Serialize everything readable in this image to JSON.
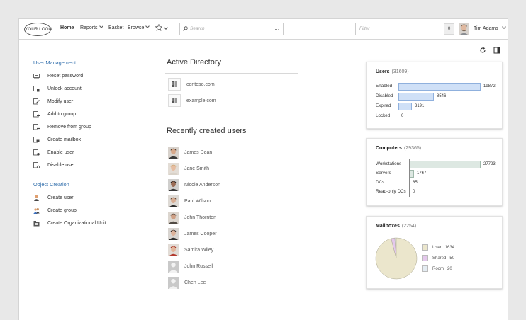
{
  "header": {
    "logo": "YOUR LOGO",
    "nav": {
      "home": "Home",
      "reports": "Reports",
      "basket": "Basket",
      "browse": "Browse"
    },
    "search_placeholder": "Search",
    "search_more": "...",
    "filter_placeholder": "Filter",
    "basket_count": "0",
    "user_name": "Tim Adams"
  },
  "sidebar": {
    "user_management": {
      "heading": "User Management",
      "items": [
        "Reset password",
        "Unlock account",
        "Modify user",
        "Add to group",
        "Remove from group",
        "Create mailbox",
        "Enable user",
        "Disable user"
      ]
    },
    "object_creation": {
      "heading": "Object Creation",
      "items": [
        "Create user",
        "Create group",
        "Create Organizational Unit"
      ]
    }
  },
  "active_directory": {
    "title": "Active Directory",
    "domains": [
      "contoso.com",
      "example.com"
    ]
  },
  "recent_users": {
    "title": "Recently created users",
    "users": [
      "James Dean",
      "Jane Smith",
      "Nicole Anderson",
      "Paul Wilson",
      "John Thornton",
      "James Cooper",
      "Samira Wiley",
      "John Russell",
      "Chen Lee"
    ]
  },
  "widgets": {
    "users": {
      "title": "Users",
      "count": "(31609)",
      "chart_data": {
        "type": "bar",
        "categories": [
          "Enabled",
          "Disabled",
          "Expired",
          "Locked"
        ],
        "values": [
          19872,
          8546,
          3191,
          0
        ],
        "value_labels": [
          "19872",
          "8546",
          "3191",
          "0"
        ],
        "color": "#cfe0f7",
        "border": "#8fb0dd"
      }
    },
    "computers": {
      "title": "Computers",
      "count": "(29365)",
      "chart_data": {
        "type": "bar",
        "categories": [
          "Workstations",
          "Servers",
          "DCs",
          "Read-only DCs"
        ],
        "values": [
          27723,
          1767,
          85,
          0
        ],
        "value_labels": [
          "27723",
          "1767",
          "85",
          "0"
        ],
        "color": "#dde8e2",
        "border": "#9fb8aa"
      }
    },
    "mailboxes": {
      "title": "Mailboxes",
      "count": "(2254)",
      "chart_data": {
        "type": "pie",
        "categories": [
          "User",
          "Shared",
          "Room"
        ],
        "values": [
          1634,
          50,
          20
        ],
        "value_labels": [
          "1634",
          "50",
          "20"
        ],
        "colors": [
          "#ebe6cc",
          "#e4c8ec",
          "#e4ecf2"
        ],
        "more": "..."
      }
    }
  }
}
